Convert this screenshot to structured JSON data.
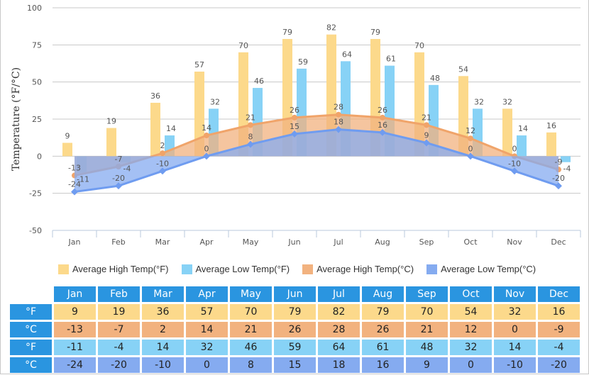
{
  "chart_data": {
    "type": "bar",
    "title": "",
    "xlabel": "",
    "ylabel": "Temperature (°F/°C)",
    "ylim": [
      -50,
      100
    ],
    "yticks": [
      100,
      75,
      50,
      25,
      0,
      -25,
      -50
    ],
    "grid": true,
    "legend_position": "bottom",
    "categories": [
      "Jan",
      "Feb",
      "Mar",
      "Apr",
      "May",
      "Jun",
      "Jul",
      "Aug",
      "Sep",
      "Oct",
      "Nov",
      "Dec"
    ],
    "series": [
      {
        "name": "Average High Temp(°F)",
        "kind": "bar",
        "color": "#fcd98b",
        "values": [
          9,
          19,
          36,
          57,
          70,
          79,
          82,
          79,
          70,
          54,
          32,
          16
        ]
      },
      {
        "name": "Average Low Temp(°F)",
        "kind": "bar",
        "color": "#87d2f6",
        "values": [
          -11,
          -4,
          14,
          32,
          46,
          59,
          64,
          61,
          48,
          32,
          14,
          -4
        ]
      },
      {
        "name": "Average High Temp(°C)",
        "kind": "area",
        "color": "#f2b27f",
        "values": [
          -13,
          -7,
          2,
          14,
          21,
          26,
          28,
          26,
          21,
          12,
          0,
          -9
        ]
      },
      {
        "name": "Average Low Temp(°C)",
        "kind": "area",
        "color": "#85abf0",
        "values": [
          -24,
          -20,
          -10,
          0,
          8,
          15,
          18,
          16,
          9,
          0,
          -10,
          -20
        ]
      }
    ]
  },
  "legend": [
    {
      "label": "Average High Temp(°F)",
      "color": "#fcd98b"
    },
    {
      "label": "Average Low Temp(°F)",
      "color": "#87d2f6"
    },
    {
      "label": "Average High Temp(°C)",
      "color": "#f2b27f"
    },
    {
      "label": "Average Low Temp(°C)",
      "color": "#85abf0"
    }
  ],
  "table": {
    "months": [
      "Jan",
      "Feb",
      "Mar",
      "Apr",
      "May",
      "Jun",
      "Jul",
      "Aug",
      "Sep",
      "Oct",
      "Nov",
      "Dec"
    ],
    "rows": [
      {
        "unit": "°F",
        "values": [
          "9",
          "19",
          "36",
          "57",
          "70",
          "79",
          "82",
          "79",
          "70",
          "54",
          "32",
          "16"
        ]
      },
      {
        "unit": "°C",
        "values": [
          "-13",
          "-7",
          "2",
          "14",
          "21",
          "26",
          "28",
          "26",
          "21",
          "12",
          "0",
          "-9"
        ]
      },
      {
        "unit": "°F",
        "values": [
          "-11",
          "-4",
          "14",
          "32",
          "46",
          "59",
          "64",
          "61",
          "48",
          "32",
          "14",
          "-4"
        ]
      },
      {
        "unit": "°C",
        "values": [
          "-24",
          "-20",
          "-10",
          "0",
          "8",
          "15",
          "18",
          "16",
          "9",
          "0",
          "-10",
          "-20"
        ]
      }
    ]
  }
}
